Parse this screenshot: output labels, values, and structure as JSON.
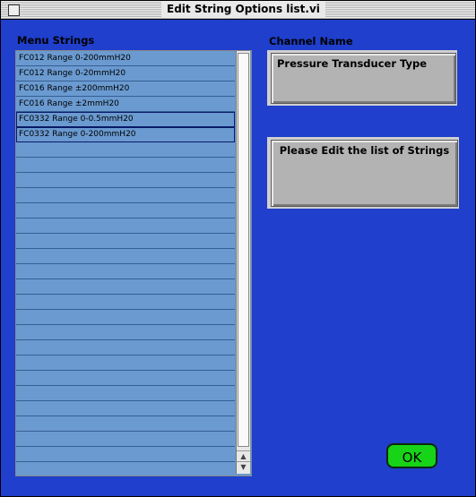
{
  "window": {
    "title": "Edit String Options list.vi"
  },
  "labels": {
    "menu_strings": "Menu Strings",
    "channel_name": "Channel Name"
  },
  "channel": {
    "value": "Pressure Transducer Type"
  },
  "message": {
    "text": "Please Edit the list of Strings"
  },
  "menu_items": [
    "FC012 Range 0-200mmH20",
    "FC012 Range 0-20mmH20",
    "FC016 Range ±200mmH20",
    "FC016 Range ±2mmH20",
    "FC0332 Range 0-0.5mmH20",
    "FC0332 Range 0-200mmH20"
  ],
  "selected_items": [
    4,
    5
  ],
  "list_row_count": 28,
  "buttons": {
    "ok_label": "OK"
  },
  "icons": {
    "scroll_up": "▲",
    "scroll_down": "▼"
  },
  "colors": {
    "panel_bg": "#1f3fcc",
    "list_bg": "#6a9ad0",
    "ok_button": "#18d418"
  }
}
